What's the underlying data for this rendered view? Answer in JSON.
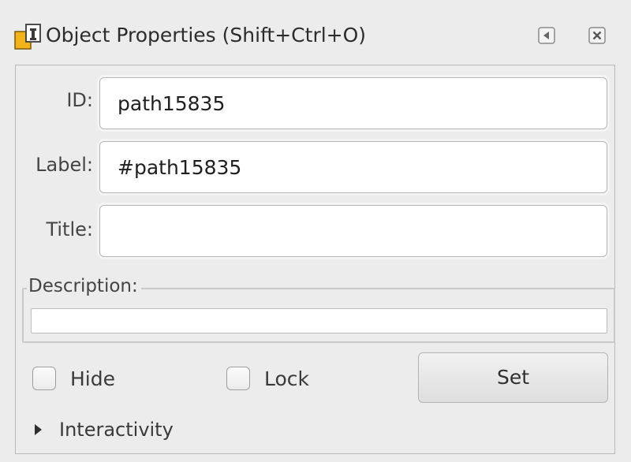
{
  "window": {
    "title": "Object Properties (Shift+Ctrl+O)",
    "icon": "object-properties-icon",
    "buttons": [
      "collapse-left-icon",
      "close-icon"
    ]
  },
  "fields": {
    "id": {
      "label": "ID:",
      "value": "path15835"
    },
    "label": {
      "label": "Label:",
      "value": "#path15835"
    },
    "title": {
      "label": "Title:",
      "value": ""
    }
  },
  "description": {
    "label": "Description:",
    "value": ""
  },
  "checkboxes": {
    "hide": {
      "label": "Hide",
      "checked": false
    },
    "lock": {
      "label": "Lock",
      "checked": false
    }
  },
  "set_button": {
    "label": "Set"
  },
  "expander": {
    "label": "Interactivity",
    "expanded": false
  },
  "colors": {
    "background": "#ececec",
    "field_bg": "#ffffff",
    "border": "#b7b7b7",
    "icon_accent": "#f2b21a"
  }
}
